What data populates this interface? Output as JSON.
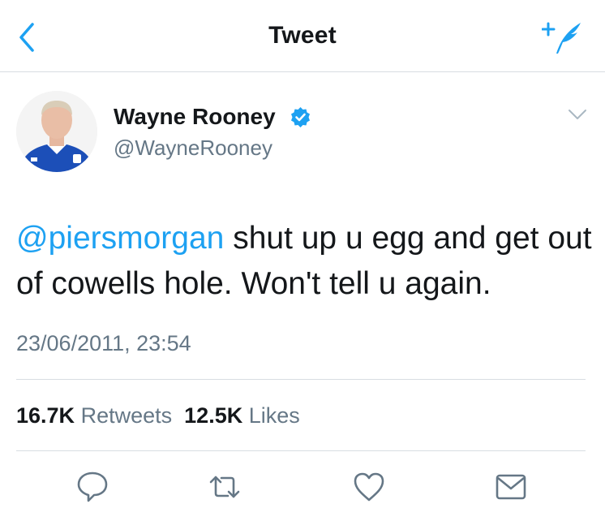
{
  "nav": {
    "title": "Tweet"
  },
  "author": {
    "name": "Wayne Rooney",
    "handle": "@WayneRooney"
  },
  "tweet": {
    "mention": "@piersmorgan",
    "text": " shut up u egg and get out of cowells hole. Won't tell u again.",
    "timestamp": "23/06/2011, 23:54"
  },
  "stats": {
    "retweets_count": "16.7K",
    "retweets_label": "Retweets",
    "likes_count": "12.5K",
    "likes_label": "Likes"
  },
  "colors": {
    "accent": "#1da1f2",
    "text_primary": "#14171a",
    "text_secondary": "#657786",
    "divider": "#d8dde2"
  },
  "icons": {
    "back": "chevron-left-icon",
    "compose": "compose-quill-icon",
    "verified": "verified-badge-icon",
    "caret": "chevron-down-icon",
    "reply": "reply-icon",
    "retweet": "retweet-icon",
    "like": "heart-icon",
    "message": "envelope-icon"
  }
}
